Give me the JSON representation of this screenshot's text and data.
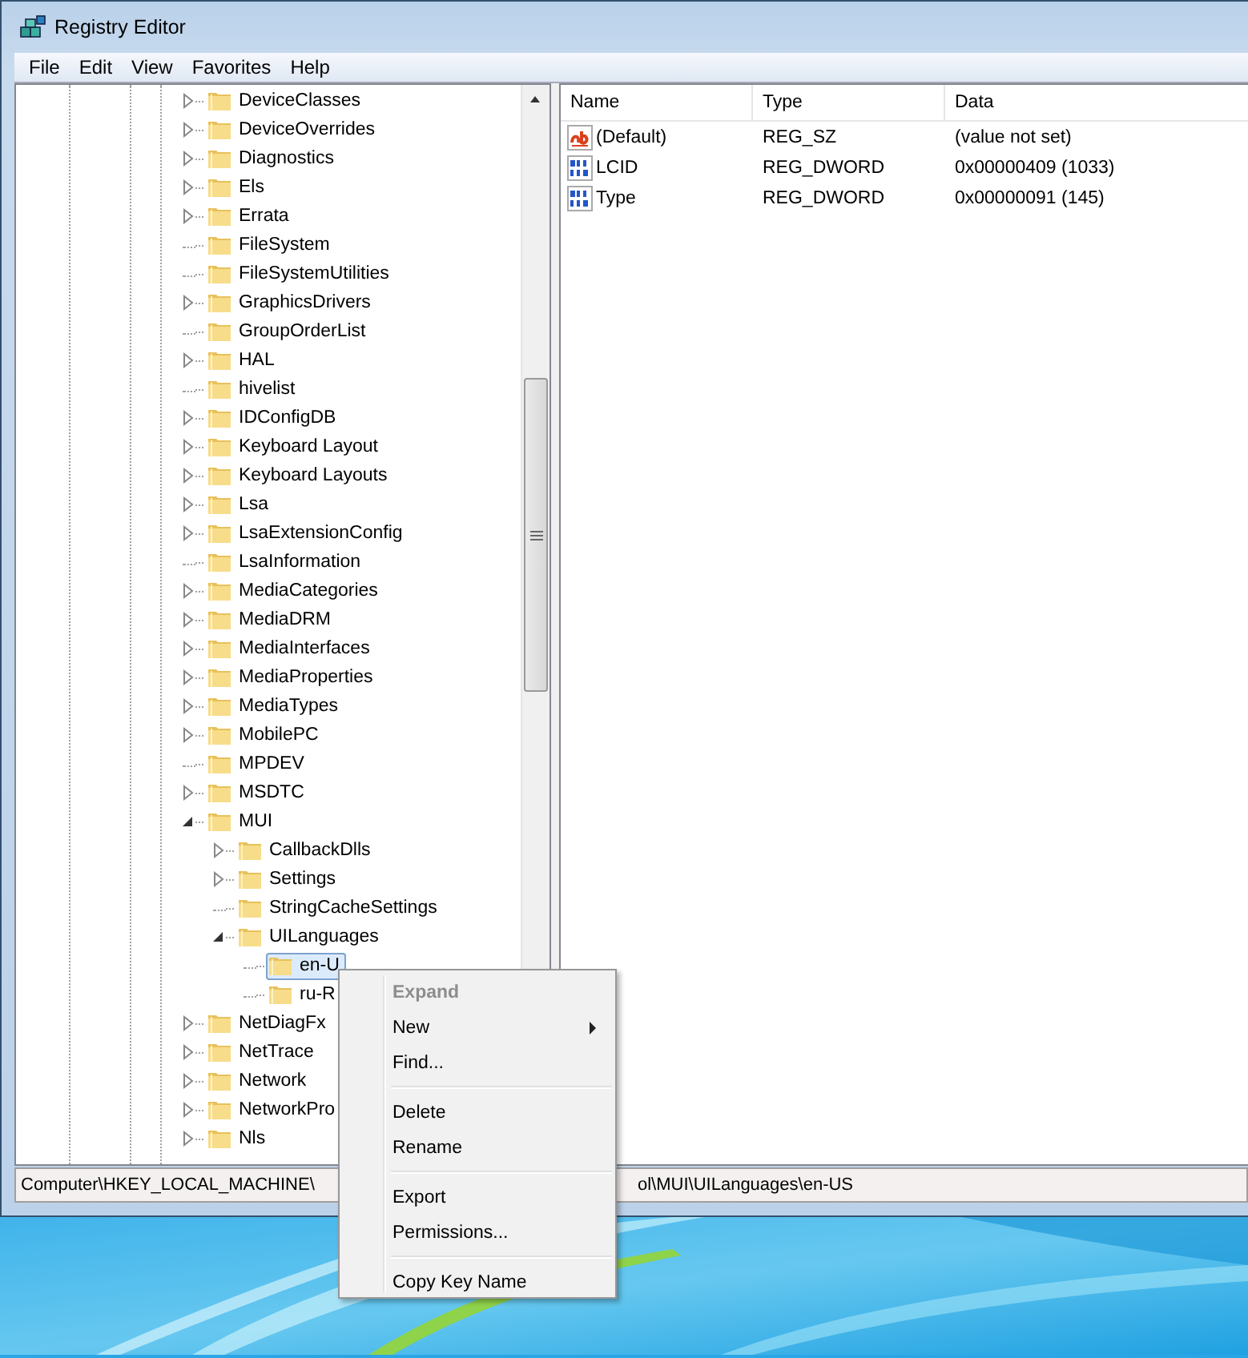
{
  "window": {
    "title": "Registry Editor"
  },
  "menu_bar": [
    "File",
    "Edit",
    "View",
    "Favorites",
    "Help"
  ],
  "tree": [
    {
      "label": "DeviceClasses",
      "expanded": false,
      "selected": false
    },
    {
      "label": "DeviceOverrides",
      "expanded": false,
      "selected": false
    },
    {
      "label": "Diagnostics",
      "expanded": false,
      "selected": false
    },
    {
      "label": "Els",
      "expanded": false,
      "selected": false
    },
    {
      "label": "Errata",
      "expanded": false,
      "selected": false
    },
    {
      "label": "FileSystem",
      "selected": false
    },
    {
      "label": "FileSystemUtilities",
      "selected": false
    },
    {
      "label": "GraphicsDrivers",
      "expanded": false,
      "selected": false
    },
    {
      "label": "GroupOrderList",
      "selected": false
    },
    {
      "label": "HAL",
      "expanded": false,
      "selected": false
    },
    {
      "label": "hivelist",
      "selected": false
    },
    {
      "label": "IDConfigDB",
      "expanded": false,
      "selected": false
    },
    {
      "label": "Keyboard Layout",
      "expanded": false,
      "selected": false
    },
    {
      "label": "Keyboard Layouts",
      "expanded": false,
      "selected": false
    },
    {
      "label": "Lsa",
      "expanded": false,
      "selected": false
    },
    {
      "label": "LsaExtensionConfig",
      "expanded": false,
      "selected": false
    },
    {
      "label": "LsaInformation",
      "selected": false
    },
    {
      "label": "MediaCategories",
      "expanded": false,
      "selected": false
    },
    {
      "label": "MediaDRM",
      "expanded": false,
      "selected": false
    },
    {
      "label": "MediaInterfaces",
      "expanded": false,
      "selected": false
    },
    {
      "label": "MediaProperties",
      "expanded": false,
      "selected": false
    },
    {
      "label": "MediaTypes",
      "expanded": false,
      "selected": false
    },
    {
      "label": "MobilePC",
      "expanded": false,
      "selected": false
    },
    {
      "label": "MPDEV",
      "selected": false
    },
    {
      "label": "MSDTC",
      "expanded": false,
      "selected": false
    },
    {
      "label": "MUI",
      "expanded": true,
      "selected": false,
      "children": [
        {
          "label": "CallbackDlls",
          "expanded": false,
          "selected": false
        },
        {
          "label": "Settings",
          "expanded": false,
          "selected": false
        },
        {
          "label": "StringCacheSettings",
          "selected": false
        },
        {
          "label": "UILanguages",
          "expanded": true,
          "selected": false,
          "children": [
            {
              "label": "en-U",
              "selected": true
            },
            {
              "label": "ru-R",
              "selected": false
            }
          ]
        }
      ]
    },
    {
      "label": "NetDiagFx",
      "expanded": false,
      "selected": false
    },
    {
      "label": "NetTrace",
      "expanded": false,
      "selected": false
    },
    {
      "label": "Network",
      "expanded": false,
      "selected": false
    },
    {
      "label": "NetworkPro",
      "expanded": false,
      "selected": false
    },
    {
      "label": "Nls",
      "expanded": false,
      "selected": false
    }
  ],
  "values": {
    "columns": [
      "Name",
      "Type",
      "Data"
    ],
    "rows": [
      {
        "kind": "string",
        "name": "(Default)",
        "type": "REG_SZ",
        "data": "(value not set)"
      },
      {
        "kind": "dword",
        "name": "LCID",
        "type": "REG_DWORD",
        "data": "0x00000409 (1033)"
      },
      {
        "kind": "dword",
        "name": "Type",
        "type": "REG_DWORD",
        "data": "0x00000091 (145)"
      }
    ]
  },
  "status_bar": [
    "Computer\\HKEY_LOCAL_MACHINE\\",
    "ol\\MUI\\UILanguages\\en-US"
  ],
  "context_menu": [
    {
      "kind": "item",
      "label": "Expand",
      "default": true,
      "disabled": true,
      "submenu": false
    },
    {
      "kind": "item",
      "label": "New",
      "default": false,
      "disabled": false,
      "submenu": true
    },
    {
      "kind": "item",
      "label": "Find...",
      "default": false,
      "disabled": false,
      "submenu": false
    },
    {
      "kind": "separator"
    },
    {
      "kind": "item",
      "label": "Delete",
      "default": false,
      "disabled": false,
      "submenu": false
    },
    {
      "kind": "item",
      "label": "Rename",
      "default": false,
      "disabled": false,
      "submenu": false
    },
    {
      "kind": "separator"
    },
    {
      "kind": "item",
      "label": "Export",
      "default": false,
      "disabled": false,
      "submenu": false
    },
    {
      "kind": "item",
      "label": "Permissions...",
      "default": false,
      "disabled": false,
      "submenu": false
    },
    {
      "kind": "separator"
    },
    {
      "kind": "item",
      "label": "Copy Key Name",
      "default": false,
      "disabled": false,
      "submenu": false
    }
  ]
}
